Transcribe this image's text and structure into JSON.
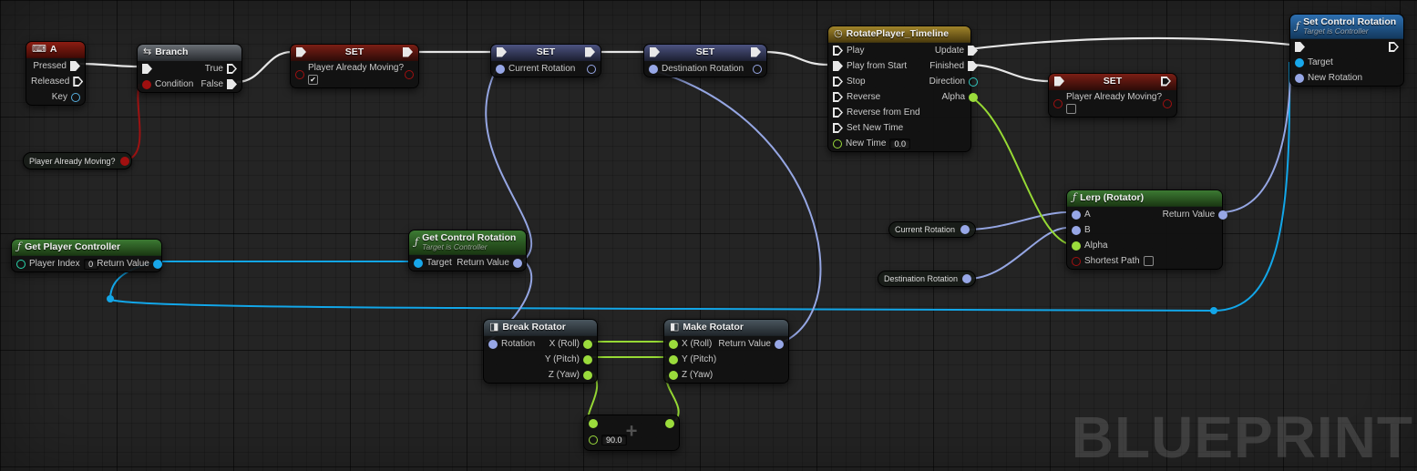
{
  "watermark": "BLUEPRINT",
  "colors": {
    "exec_wire": "#e6e6e6",
    "bool": "#a01010",
    "rotator": "#97a7e6",
    "object": "#18a7ea",
    "float": "#9bdc3c",
    "integer": "#2bd6ae"
  },
  "icons": {
    "keyboard": "⌨",
    "branch": "⇆",
    "timeline": "◷",
    "function": "ƒ",
    "break": "◨",
    "make": "◧",
    "add": "+"
  },
  "nodes": {
    "key_event_a": {
      "title": "A",
      "pins": {
        "pressed": "Pressed",
        "released": "Released",
        "key": "Key"
      }
    },
    "branch": {
      "title": "Branch",
      "pins": {
        "condition": "Condition",
        "true": "True",
        "false": "False"
      }
    },
    "set_moving_true": {
      "title": "SET",
      "variable": "Player Already Moving?",
      "value_checked": true
    },
    "set_current_rotation": {
      "title": "SET",
      "variable": "Current Rotation"
    },
    "set_destination_rotation": {
      "title": "SET",
      "variable": "Destination Rotation"
    },
    "timeline": {
      "title": "RotatePlayer_Timeline",
      "inputs": [
        "Play",
        "Play from Start",
        "Stop",
        "Reverse",
        "Reverse from End",
        "Set New Time",
        "New Time"
      ],
      "new_time_value": "0.0",
      "outputs": [
        "Update",
        "Finished",
        "Direction",
        "Alpha"
      ]
    },
    "set_moving_false": {
      "title": "SET",
      "variable": "Player Already Moving?",
      "value_checked": false
    },
    "lerp_rotator": {
      "title": "Lerp (Rotator)",
      "inputs": [
        "A",
        "B",
        "Alpha",
        "Shortest Path"
      ],
      "output": "Return Value"
    },
    "set_control_rotation": {
      "title": "Set Control Rotation",
      "subtitle": "Target is Controller",
      "inputs": [
        "Target",
        "New Rotation"
      ]
    },
    "get_player_controller": {
      "title": "Get Player Controller",
      "input": "Player Index",
      "input_value": "0",
      "output": "Return Value"
    },
    "get_control_rotation": {
      "title": "Get Control Rotation",
      "subtitle": "Target is Controller",
      "input": "Target",
      "output": "Return Value"
    },
    "get_player_already_moving": {
      "label": "Player Already Moving?"
    },
    "get_current_rotation": {
      "label": "Current Rotation"
    },
    "get_destination_rotation": {
      "label": "Destination Rotation"
    },
    "break_rotator": {
      "title": "Break Rotator",
      "input": "Rotation",
      "outputs": [
        "X (Roll)",
        "Y (Pitch)",
        "Z (Yaw)"
      ]
    },
    "make_rotator": {
      "title": "Make Rotator",
      "inputs": [
        "X (Roll)",
        "Y (Pitch)",
        "Z (Yaw)"
      ],
      "output": "Return Value"
    },
    "add_float": {
      "operator": "+",
      "value": "90.0"
    }
  }
}
